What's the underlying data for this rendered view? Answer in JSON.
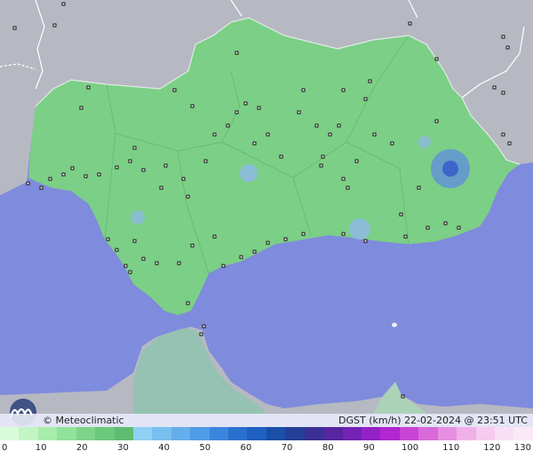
{
  "credits": {
    "brand": "© Meteoclimatic",
    "variable": "DGST (km/h)",
    "timestamp": "22-02-2024 @ 23:51 UTC"
  },
  "colors": {
    "sea": "#7f8bdc",
    "land_other": "#b6b9c2",
    "region": "#7ccf86",
    "border": "#ffffff"
  },
  "scale": {
    "labels": [
      "0",
      "10",
      "20",
      "30",
      "40",
      "50",
      "60",
      "70",
      "80",
      "90",
      "100",
      "110",
      "120",
      "130"
    ],
    "colors": [
      "#d9fbd9",
      "#c4f5c4",
      "#a9ecac",
      "#92e39a",
      "#7ed58a",
      "#6cc87b",
      "#5fbc72",
      "#8fd0f3",
      "#79bff0",
      "#65aeec",
      "#4f9be6",
      "#3a86dc",
      "#2a71cf",
      "#1f5fbf",
      "#1a4fa8",
      "#243f96",
      "#3b2f96",
      "#5626a0",
      "#7322b4",
      "#9322c6",
      "#b026cf",
      "#c843d6",
      "#d96ad9",
      "#e68fe1",
      "#efb0e8",
      "#f5cbef",
      "#f9dff4",
      "#fbe9f8"
    ]
  }
}
